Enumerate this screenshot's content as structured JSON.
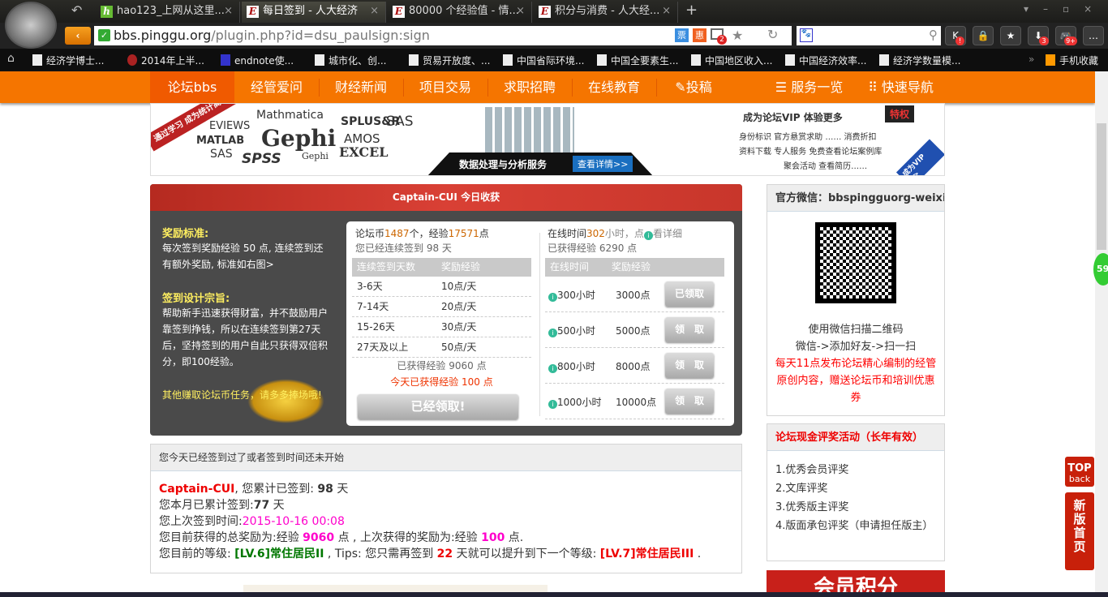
{
  "browser": {
    "tabs": [
      {
        "label": "hao123_上网从这里..."
      },
      {
        "label": "每日签到 - 人大经济"
      },
      {
        "label": "80000 个经验值 - 情..."
      },
      {
        "label": "积分与消费 - 人大经..."
      }
    ],
    "url_host": "bbs.pinggu.org",
    "url_path": "/plugin.php?id=dsu_paulsign:sign",
    "badges": {
      "tab_count": "2",
      "k": "!",
      "download": "3",
      "game": "9+"
    },
    "bookmarks": [
      "经济学博士...",
      "2014年上半...",
      "endnote使...",
      "城市化、创...",
      "贸易开放度、...",
      "中国省际环境...",
      "中国全要素生...",
      "中国地区收入...",
      "中国经济效率...",
      "经济学数量模..."
    ],
    "mobile_fav": "手机收藏"
  },
  "nav": {
    "items": [
      "论坛bbs",
      "经管爱问",
      "财经新闻",
      "项目交易",
      "求职招聘",
      "在线教育",
      "投稿"
    ],
    "services": "服务一览",
    "quick": "快速导航"
  },
  "banner": {
    "left_tag": "通过学习 成为统计高手",
    "tools": [
      "Mathmatica",
      "EVIEWS",
      "Gephi",
      "SPLUS&R",
      "SAS",
      "MATLAB",
      "AMOS",
      "SAS",
      "SPSS",
      "Gephi",
      "EXCEL"
    ],
    "center": "数据处理与分析服务",
    "center_btn": "查看详情>>",
    "vip_title": "成为论坛VIP 体验更多",
    "vip_badge": "特权",
    "vip_lines": [
      "身份标识 官方悬赏求助 …… 消费折扣",
      "资料下载 专人服务 免费查看论坛案例库",
      "聚会活动 查看简历……"
    ],
    "vip_corner": "成为VIP >>"
  },
  "sign": {
    "title": "Captain-CUI 今日收获",
    "reward_title": "奖励标准:",
    "reward_text": "每次签到奖励经验 50 点, 连续签到还有额外奖励, 标准如右图>",
    "design_title": "签到设计宗旨:",
    "design_text": "帮助新手迅速获得财富，并不鼓励用户靠签到挣钱，所以在连续签到第27天后，坚持签到的用户自此只获得双倍积分，即100经验。",
    "other": "其他赚取论坛币任务，请多多捧场哦!",
    "coins_label": "论坛币",
    "coins": "1487",
    "coins_unit": "个，经验",
    "exp": "17571",
    "exp_unit": "点",
    "streak": "您已经连续签到 98 天",
    "table_headers": [
      "连续签到天数",
      "奖励经验"
    ],
    "table": [
      [
        "3-6天",
        "10点/天"
      ],
      [
        "7-14天",
        "20点/天"
      ],
      [
        "15-26天",
        "30点/天"
      ],
      [
        "27天及以上",
        "50点/天"
      ]
    ],
    "earned": "已获得经验 9060 点",
    "today": "今天已获得经验 100 点",
    "claimed_btn": "已经领取!",
    "online_label": "在线时间",
    "online_hours": "302",
    "online_unit": "小时，点",
    "detail": "看详细",
    "online_earned": "已获得经验 6290 点",
    "online_headers": [
      "在线时间",
      "奖励经验"
    ],
    "online": [
      {
        "hours": "300小时",
        "exp": "3000点",
        "btn": "已领取"
      },
      {
        "hours": "500小时",
        "exp": "5000点",
        "btn": "领　取"
      },
      {
        "hours": "800小时",
        "exp": "8000点",
        "btn": "领　取"
      },
      {
        "hours": "1000小时",
        "exp": "10000点",
        "btn": "领　取"
      }
    ]
  },
  "status": {
    "header": "您今天已经签到过了或者签到时间还未开始",
    "user": "Captain-CUI",
    "l1a": ", 您累计已签到: ",
    "total_days": "98",
    "day": " 天",
    "l2a": "您本月已累计签到:",
    "month_days": "77",
    "l3a": "您上次签到时间:",
    "last_time": "2015-10-16 00:08",
    "l4a": "您目前获得的总奖励为:经验 ",
    "total_exp": "9060",
    "l4b": " 点 , 上次获得的奖励为:经验 ",
    "last_exp": "100",
    "l4c": " 点.",
    "l5a": "您目前的等级: ",
    "level": "[LV.6]常住居民II",
    "l5b": " , Tips: 您只需再签到 ",
    "need": "22",
    "l5c": " 天就可以提升到下一个等级: ",
    "next_level": "[LV.7]常住居民III",
    "l5d": " ."
  },
  "sidebar": {
    "wechat_title": "官方微信：bbspingguorg-weixin",
    "scan1": "使用微信扫描二维码",
    "scan2": "微信->添加好友->扫一扫",
    "promo": "每天11点发布论坛精心编制的经管原创内容，赠送论坛币和培训优惠券",
    "award_title": "论坛现金评奖活动（长年有效）",
    "awards": [
      "1.优秀会员评奖",
      "2.文库评奖",
      "3.优秀版主评奖",
      "4.版面承包评奖（申请担任版主）"
    ],
    "red_banner": "会员积分"
  },
  "floating": {
    "top": "TOP",
    "back": "back",
    "new_home": "新版首页",
    "green_badge": "59"
  }
}
